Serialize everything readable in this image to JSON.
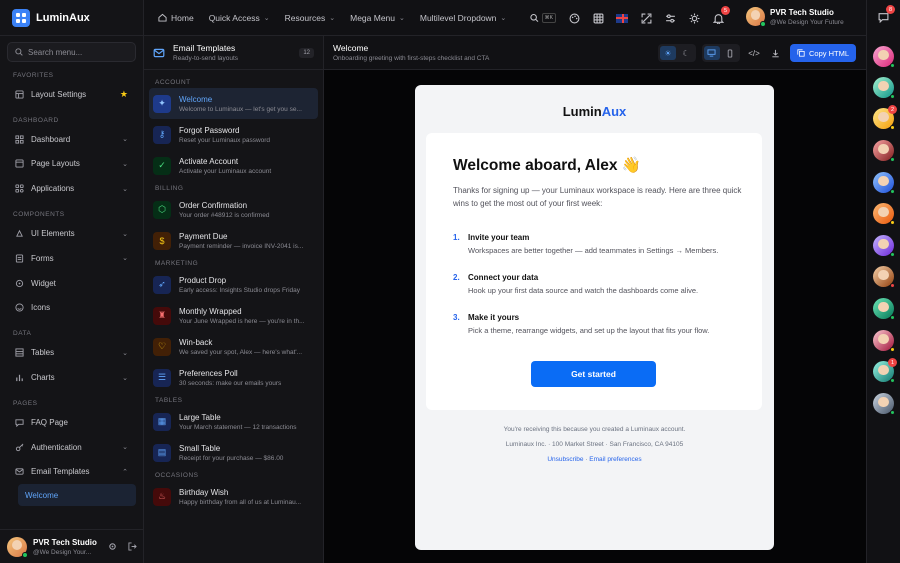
{
  "brand": {
    "name": "LuminAux"
  },
  "sidebar": {
    "search_placeholder": "Search menu...",
    "sections": {
      "favorites": "FAVORITES",
      "dashboard": "DASHBOARD",
      "components": "COMPONENTS",
      "data": "DATA",
      "pages": "PAGES"
    },
    "items": {
      "layout_settings": "Layout Settings",
      "dashboard": "Dashboard",
      "page_layouts": "Page Layouts",
      "applications": "Applications",
      "ui_elements": "UI Elements",
      "forms": "Forms",
      "widget": "Widget",
      "icons": "Icons",
      "tables": "Tables",
      "charts": "Charts",
      "faq_page": "FAQ Page",
      "authentication": "Authentication",
      "email_templates": "Email Templates",
      "welcome": "Welcome"
    },
    "footer": {
      "name": "PVR Tech Studio",
      "sub": "@We Design Your..."
    }
  },
  "topbar": {
    "nav": {
      "home": "Home",
      "quick_access": "Quick Access",
      "resources": "Resources",
      "mega_menu": "Mega Menu",
      "multilevel": "Multilevel Dropdown"
    },
    "kbd": "⌘K",
    "notifications_count": "5",
    "user": {
      "name": "PVR Tech Studio",
      "sub": "@We Design Your Future"
    }
  },
  "rail": {
    "badges": {
      "first": "8",
      "third": "2",
      "ninth": "1"
    }
  },
  "templates": {
    "header": {
      "title": "Email Templates",
      "sub": "Ready-to-send layouts",
      "count": "12"
    },
    "sections": {
      "account": "ACCOUNT",
      "billing": "BILLING",
      "marketing": "MARKETING",
      "tables": "TABLES",
      "occasions": "OCCASIONS"
    },
    "items": {
      "welcome": {
        "title": "Welcome",
        "desc": "Welcome to Luminaux — let's get you se..."
      },
      "forgot": {
        "title": "Forgot Password",
        "desc": "Reset your Luminaux password"
      },
      "activate": {
        "title": "Activate Account",
        "desc": "Activate your Luminaux account"
      },
      "order": {
        "title": "Order Confirmation",
        "desc": "Your order #48912 is confirmed"
      },
      "payment": {
        "title": "Payment Due",
        "desc": "Payment reminder — invoice INV-2041 is..."
      },
      "product": {
        "title": "Product Drop",
        "desc": "Early access: Insights Studio drops Friday"
      },
      "monthly": {
        "title": "Monthly Wrapped",
        "desc": "Your June Wrapped is here — you're in th..."
      },
      "winback": {
        "title": "Win-back",
        "desc": "We saved your spot, Alex — here's what'..."
      },
      "poll": {
        "title": "Preferences Poll",
        "desc": "30 seconds: make our emails yours"
      },
      "large": {
        "title": "Large Table",
        "desc": "Your March statement — 12 transactions"
      },
      "small": {
        "title": "Small Table",
        "desc": "Receipt for your purchase — $86.00"
      },
      "birthday": {
        "title": "Birthday Wish",
        "desc": "Happy birthday from all of us at Luminau..."
      }
    }
  },
  "preview": {
    "title": "Welcome",
    "sub": "Onboarding greeting with first-steps checklist and CTA",
    "copy_label": "Copy HTML"
  },
  "email": {
    "logo_a": "Lumin",
    "logo_b": "Aux",
    "heading": "Welcome aboard, Alex 👋",
    "intro": "Thanks for signing up — your Luminaux workspace is ready. Here are three quick wins to get the most out of your first week:",
    "steps": [
      {
        "n": "1.",
        "title": "Invite your team",
        "desc": "Workspaces are better together — add teammates in Settings → Members."
      },
      {
        "n": "2.",
        "title": "Connect your data",
        "desc": "Hook up your first data source and watch the dashboards come alive."
      },
      {
        "n": "3.",
        "title": "Make it yours",
        "desc": "Pick a theme, rearrange widgets, and set up the layout that fits your flow."
      }
    ],
    "cta": "Get started",
    "footer_reason": "You're receiving this because you created a Luminaux account.",
    "footer_address": "Luminaux Inc. · 100 Market Street · San Francisco, CA 94105",
    "unsubscribe": "Unsubscribe",
    "sep": " · ",
    "preferences": "Email preferences"
  },
  "colors": {
    "accent": "#3b82f6",
    "cta": "#0a6cf5",
    "bg": "#0b0b0d"
  }
}
